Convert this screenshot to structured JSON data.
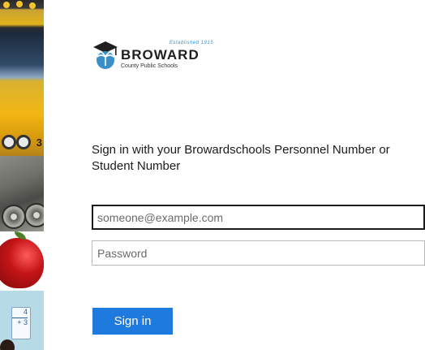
{
  "brand": {
    "name": "BROWARD",
    "tagline": "County Public Schools",
    "established": "Established 1915"
  },
  "login": {
    "heading": "Sign in with your Browardschools Personnel Number or Student Number",
    "username_placeholder": "someone@example.com",
    "password_placeholder": "Password",
    "submit_label": "Sign in"
  },
  "side_images": {
    "bus_number": "3",
    "math_card": {
      "top": "4",
      "bottom": "+ 3"
    }
  },
  "colors": {
    "accent": "#1f7ae0",
    "logo_accent": "#3a8fc9"
  },
  "icons": {
    "logo": "graduation-cap-palm-icon"
  }
}
